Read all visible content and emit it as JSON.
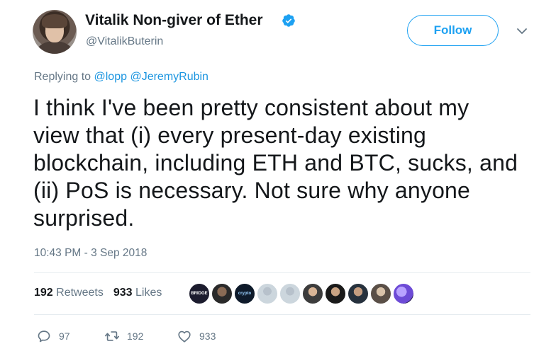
{
  "author": {
    "display_name": "Vitalik Non-giver of Ether",
    "handle": "@VitalikButerin",
    "verified_icon": "verified-badge-icon",
    "avatar_desc": "profile-photo"
  },
  "header": {
    "follow_label": "Follow",
    "menu_icon": "chevron-down-icon"
  },
  "reply": {
    "prefix": "Replying to ",
    "mentions": [
      "@lopp",
      "@JeremyRubin"
    ]
  },
  "tweet": {
    "text": "I think I've been pretty consistent about my\nview that (i) every present-day existing\nblockchain, including ETH and BTC, sucks, and\n(ii) PoS is necessary. Not sure why anyone\nsurprised.",
    "timestamp": "10:43 PM - 3 Sep 2018"
  },
  "stats": {
    "retweets_count": "192",
    "retweets_label": "Retweets",
    "likes_count": "933",
    "likes_label": "Likes",
    "liker_avatar_labels": [
      "BRIDGE",
      "",
      "crypto",
      "",
      "",
      "",
      "",
      "",
      "",
      ""
    ]
  },
  "actions": {
    "reply_count": "97",
    "retweet_count": "192",
    "like_count": "933"
  },
  "colors": {
    "accent": "#1da1f2",
    "mention": "#1b95e0",
    "secondary_text": "#657786",
    "primary_text": "#14171a"
  }
}
